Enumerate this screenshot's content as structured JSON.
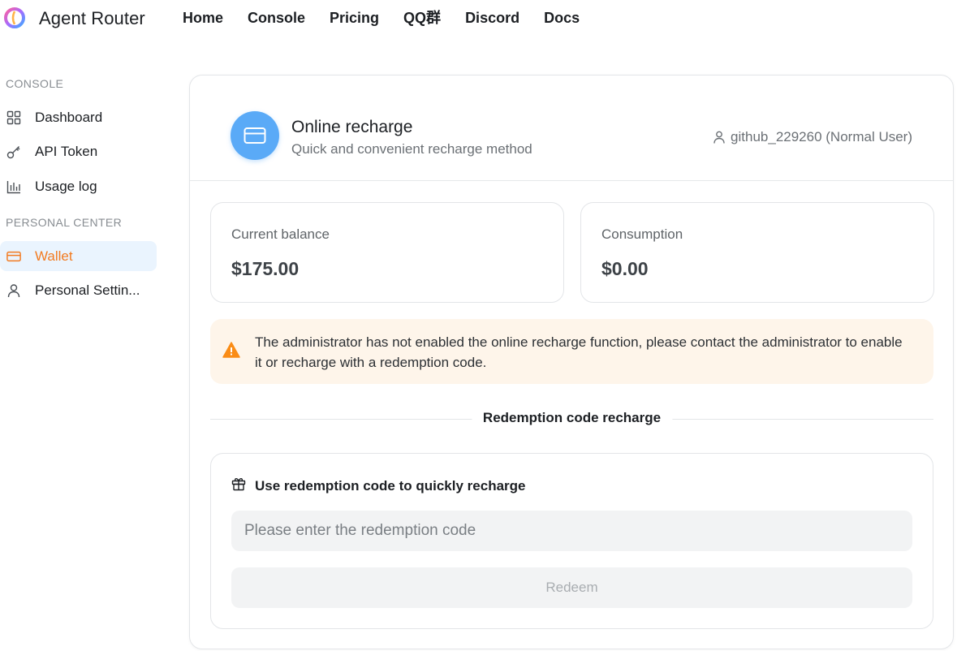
{
  "app": {
    "brand": "Agent Router"
  },
  "nav": [
    "Home",
    "Console",
    "Pricing",
    "QQ群",
    "Discord",
    "Docs"
  ],
  "sidebar": {
    "sections": [
      {
        "title": "CONSOLE"
      },
      {
        "title": "PERSONAL CENTER"
      }
    ],
    "items": [
      {
        "label": "Dashboard",
        "icon": "grid-icon"
      },
      {
        "label": "API Token",
        "icon": "key-icon"
      },
      {
        "label": "Usage log",
        "icon": "bar-chart-icon"
      },
      {
        "label": "Wallet",
        "icon": "wallet-icon",
        "active": true
      },
      {
        "label": "Personal Settin...",
        "icon": "user-icon"
      }
    ]
  },
  "header": {
    "title": "Online recharge",
    "subtitle": "Quick and convenient recharge method",
    "user": "github_229260 (Normal User)"
  },
  "stats": {
    "balance_label": "Current balance",
    "balance_value": "$175.00",
    "consumption_label": "Consumption",
    "consumption_value": "$0.00"
  },
  "alert": {
    "text": "The administrator has not enabled the online recharge function, please contact the administrator to enable it or recharge with a redemption code."
  },
  "redemption": {
    "divider_label": "Redemption code recharge",
    "heading": "Use redemption code to quickly recharge",
    "placeholder": "Please enter the redemption code",
    "button": "Redeem"
  },
  "colors": {
    "accent": "#f27b21",
    "active_bg": "#eaf4fe",
    "avatar": "#5aaaf7",
    "alert_bg": "#fef5ea",
    "warning": "#fa8c16"
  }
}
